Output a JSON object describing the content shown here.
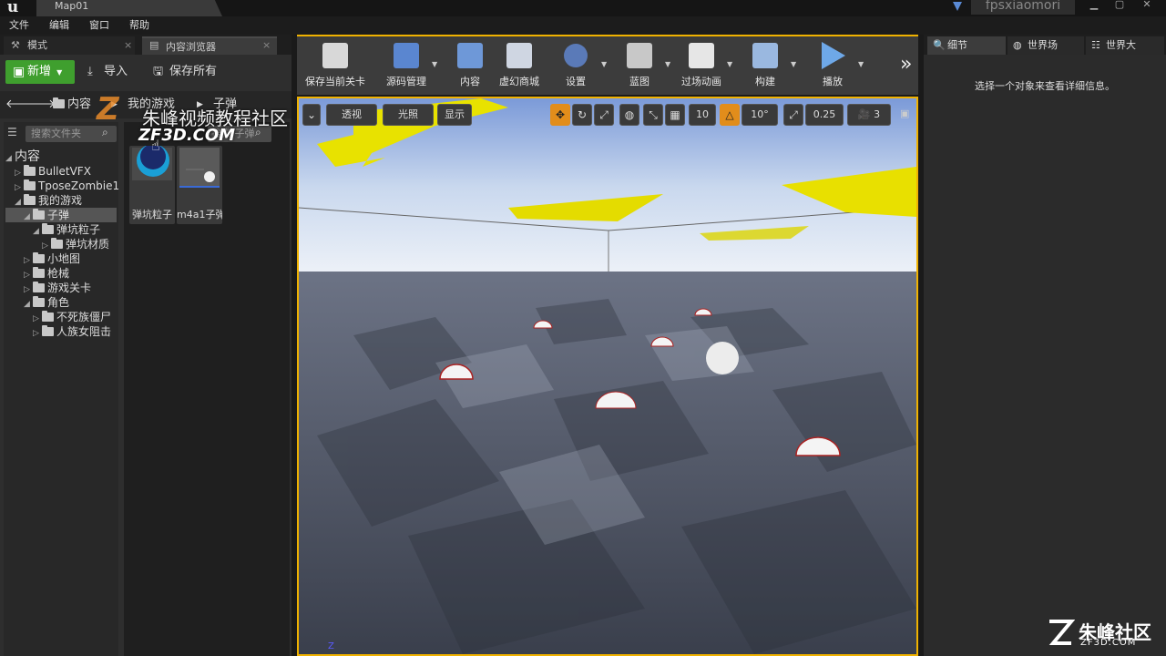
{
  "titlebar": {
    "map_tab": "Map01",
    "project": "fpsxiaomori"
  },
  "menu": [
    "文件",
    "编辑",
    "窗口",
    "帮助"
  ],
  "left_tabs": {
    "modes": "模式",
    "content_browser": "内容浏览器"
  },
  "content_browser": {
    "new_label": "新增",
    "import_label": "导入",
    "save_all_label": "保存所有",
    "breadcrumbs": [
      "内容",
      "我的游戏",
      "子弹"
    ],
    "folder_search_placeholder": "搜索文件夹",
    "asset_search_placeholder": "搜索 子弹",
    "tree": [
      {
        "label": "内容",
        "level": 0,
        "expanded": true
      },
      {
        "label": "BulletVFX",
        "level": 1,
        "expanded": false
      },
      {
        "label": "TposeZombie1",
        "level": 1,
        "expanded": false
      },
      {
        "label": "我的游戏",
        "level": 1,
        "expanded": true
      },
      {
        "label": "子弹",
        "level": 2,
        "expanded": true,
        "selected": true
      },
      {
        "label": "弹坑粒子",
        "level": 3,
        "expanded": true
      },
      {
        "label": "弹坑材质",
        "level": 4,
        "expanded": false
      },
      {
        "label": "小地图",
        "level": 2,
        "expanded": false
      },
      {
        "label": "枪械",
        "level": 2,
        "expanded": false
      },
      {
        "label": "游戏关卡",
        "level": 2,
        "expanded": false
      },
      {
        "label": "角色",
        "level": 2,
        "expanded": true
      },
      {
        "label": "不死族僵尸",
        "level": 3,
        "expanded": false
      },
      {
        "label": "人族女阻击",
        "level": 3,
        "expanded": false
      }
    ],
    "assets": [
      {
        "label": "弹坑粒子"
      },
      {
        "label": "m4a1子弹"
      }
    ]
  },
  "watermark": {
    "text": "朱峰视频教程社区",
    "sub": "ZF3D.COM"
  },
  "toolbar": {
    "buttons": [
      {
        "label": "保存当前关卡",
        "icon": "save-icon"
      },
      {
        "label": "源码管理",
        "icon": "source-control-icon"
      },
      {
        "label": "内容",
        "icon": "content-icon"
      },
      {
        "label": "虚幻商城",
        "icon": "marketplace-icon"
      },
      {
        "label": "设置",
        "icon": "settings-icon"
      },
      {
        "label": "蓝图",
        "icon": "blueprint-icon"
      },
      {
        "label": "过场动画",
        "icon": "cinematics-icon"
      },
      {
        "label": "构建",
        "icon": "build-icon"
      },
      {
        "label": "播放",
        "icon": "play-icon"
      }
    ]
  },
  "viewport": {
    "perspective": "透视",
    "lit": "光照",
    "show": "显示",
    "grid_snap": "10",
    "rotation_snap": "10°",
    "scale_snap": "0.25",
    "camera_speed": "3"
  },
  "right_tabs": {
    "details": "细节",
    "world_settings": "世界场",
    "outliner": "世界大"
  },
  "details_hint": "选择一个对象来查看详细信息。",
  "brand": {
    "name": "朱峰社区",
    "url": "ZF3D.COM"
  },
  "colors": {
    "accent": "#f0b200",
    "new_button": "#3f9f2e",
    "highlight": "#e28d1b"
  }
}
